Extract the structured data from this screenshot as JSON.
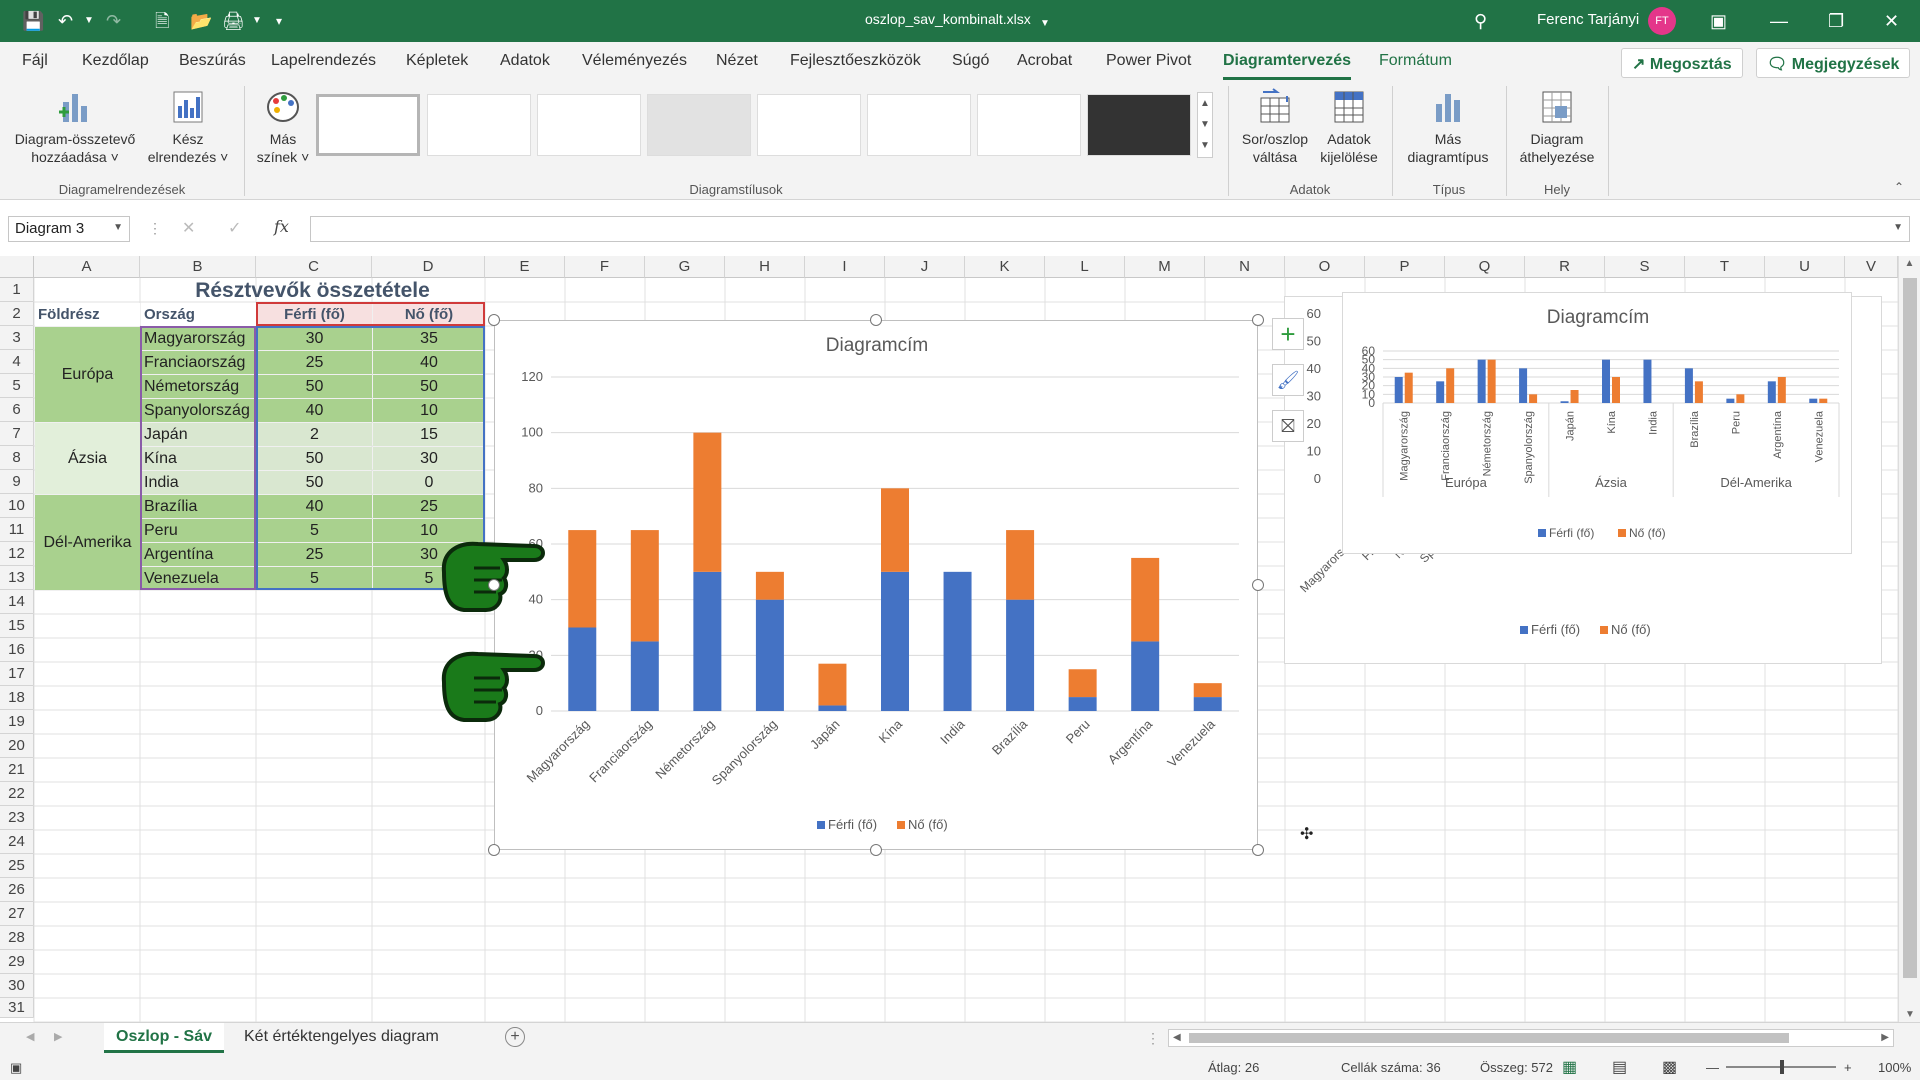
{
  "title_bar": {
    "filename": "oszlop_sav_kombinalt.xlsx",
    "user": "Ferenc Tarjányi",
    "avatar": "FT"
  },
  "ribbon_tabs": [
    "Fájl",
    "Kezdőlap",
    "Beszúrás",
    "Lapelrendezés",
    "Képletek",
    "Adatok",
    "Véleményezés",
    "Nézet",
    "Fejlesztőeszközök",
    "Súgó",
    "Acrobat",
    "Power Pivot",
    "Diagramtervezés",
    "Formátum"
  ],
  "share_label": "Megosztás",
  "comments_label": "Megjegyzések",
  "ribbon": {
    "add_element_1": "Diagram-összetevő",
    "add_element_2": "hozzáadása",
    "quick_layout_1": "Kész",
    "quick_layout_2": "elrendezés",
    "colors_1": "Más",
    "colors_2": "színek",
    "switch_1": "Sor/oszlop",
    "switch_2": "váltása",
    "select_data_1": "Adatok",
    "select_data_2": "kijelölése",
    "change_type_1": "Más",
    "change_type_2": "diagramtípus",
    "move_1": "Diagram",
    "move_2": "áthelyezése",
    "groups": {
      "layouts": "Diagramelrendezések",
      "styles": "Diagramstílusok",
      "data": "Adatok",
      "type": "Típus",
      "location": "Hely"
    }
  },
  "name_box": "Diagram 3",
  "fx_label": "fx",
  "columns": [
    "A",
    "B",
    "C",
    "D",
    "E",
    "F",
    "G",
    "H",
    "I",
    "J",
    "K",
    "L",
    "M",
    "N",
    "O",
    "P",
    "Q",
    "R",
    "S",
    "T",
    "U",
    "V"
  ],
  "rows": [
    "1",
    "2",
    "3",
    "4",
    "5",
    "6",
    "7",
    "8",
    "9",
    "10",
    "11",
    "12",
    "13",
    "14",
    "15",
    "16",
    "17",
    "18",
    "19",
    "20",
    "21",
    "22",
    "23",
    "24",
    "25",
    "26",
    "27",
    "28",
    "29",
    "30",
    "31"
  ],
  "table": {
    "title": "Résztvevők összetétele",
    "headers": [
      "Földrész",
      "Ország",
      "Férfi (fő)",
      "Nő (fő)"
    ],
    "groups": [
      {
        "name": "Európa",
        "rows": [
          [
            "Magyarország",
            "30",
            "35"
          ],
          [
            "Franciaország",
            "25",
            "40"
          ],
          [
            "Németország",
            "50",
            "50"
          ],
          [
            "Spanyolország",
            "40",
            "10"
          ]
        ]
      },
      {
        "name": "Ázsia",
        "rows": [
          [
            "Japán",
            "2",
            "15"
          ],
          [
            "Kína",
            "50",
            "30"
          ],
          [
            "India",
            "50",
            "0"
          ]
        ]
      },
      {
        "name": "Dél-Amerika",
        "rows": [
          [
            "Brazília",
            "40",
            "25"
          ],
          [
            "Peru",
            "5",
            "10"
          ],
          [
            "Argentína",
            "25",
            "30"
          ],
          [
            "Venezuela",
            "5",
            "5"
          ]
        ]
      }
    ]
  },
  "chart_data": [
    {
      "type": "bar",
      "stacked": true,
      "title": "Diagramcím",
      "categories": [
        "Magyarország",
        "Franciaország",
        "Németország",
        "Spanyolország",
        "Japán",
        "Kína",
        "India",
        "Brazília",
        "Peru",
        "Argentína",
        "Venezuela"
      ],
      "series": [
        {
          "name": "Férfi (fő)",
          "values": [
            30,
            25,
            50,
            40,
            2,
            50,
            50,
            40,
            5,
            25,
            5
          ],
          "color": "#4472c4"
        },
        {
          "name": "Nő (fő)",
          "values": [
            35,
            40,
            50,
            10,
            15,
            30,
            0,
            25,
            10,
            30,
            5
          ],
          "color": "#ed7d31"
        }
      ],
      "yticks": [
        "0",
        "20",
        "40",
        "60",
        "80",
        "100",
        "120"
      ],
      "ylim": [
        0,
        120
      ],
      "grid": true,
      "legend": "bottom"
    },
    {
      "type": "bar",
      "stacked": false,
      "title": "Diagramcím",
      "categories": [
        "Magyarország",
        "Franciaország",
        "Németország",
        "Spanyolország",
        "Japán",
        "Kína",
        "India",
        "Brazília",
        "Peru",
        "Argentína",
        "Venezuela"
      ],
      "groups": [
        "Európa",
        "Ázsia",
        "Dél-Amerika"
      ],
      "series": [
        {
          "name": "Férfi (fő)",
          "values": [
            30,
            25,
            50,
            40,
            2,
            50,
            50,
            40,
            5,
            25,
            5
          ],
          "color": "#4472c4"
        },
        {
          "name": "Nő (fő)",
          "values": [
            35,
            40,
            50,
            10,
            15,
            30,
            0,
            25,
            10,
            30,
            5
          ],
          "color": "#ed7d31"
        }
      ],
      "yticks": [
        "0",
        "10",
        "20",
        "30",
        "40",
        "50",
        "60"
      ],
      "ylim": [
        0,
        60
      ],
      "grid": true,
      "legend": "bottom"
    }
  ],
  "back_chart": {
    "yticks": [
      "0",
      "10",
      "20",
      "30",
      "40",
      "50",
      "60"
    ],
    "partial_labels": [
      "Magyarors",
      "Fr",
      "N",
      "Sp"
    ]
  },
  "sheet_tabs": [
    "Oszlop - Sáv",
    "Két értéktengelyes diagram"
  ],
  "status": {
    "average": "Átlag: 26",
    "count": "Cellák száma: 36",
    "sum": "Összeg: 572",
    "zoom": "100%"
  }
}
